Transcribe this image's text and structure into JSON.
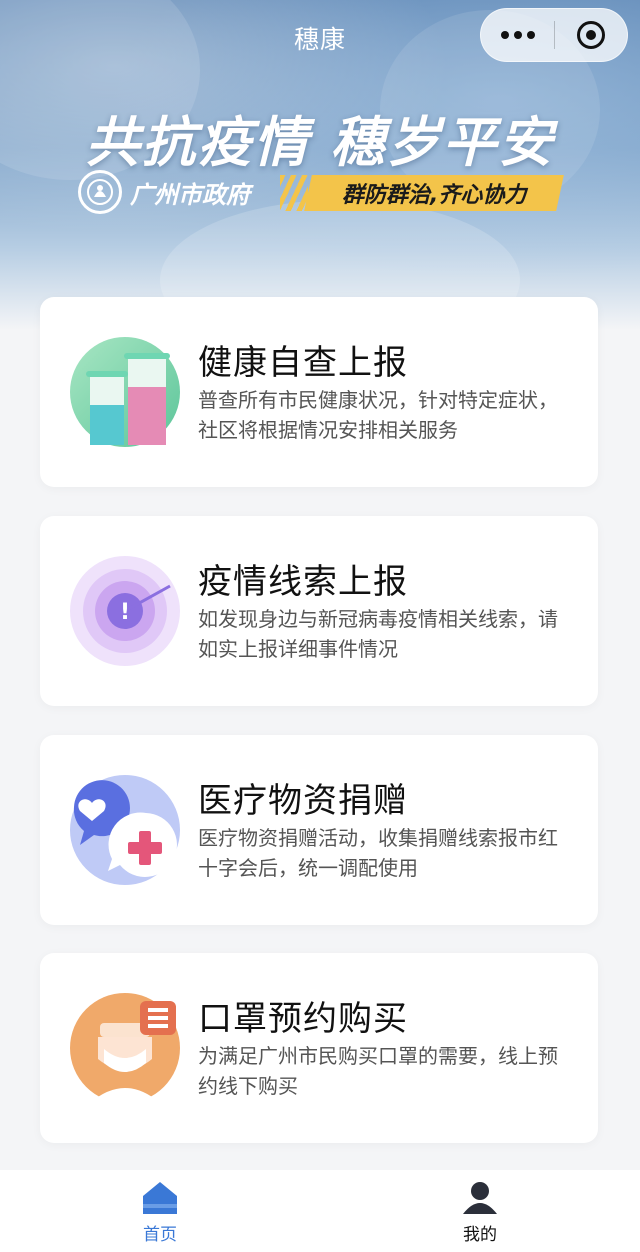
{
  "nav": {
    "title": "穗康"
  },
  "banner": {
    "slogan": "共抗疫情 穗岁平安",
    "gov_name": "广州市政府",
    "motto": "群防群治,齐心协力"
  },
  "cards": [
    {
      "title": "健康自查上报",
      "desc": "普查所有市民健康状况，针对特定症状，社区将根据情况安排相关服务",
      "icon": "test-tubes-icon"
    },
    {
      "title": "疫情线索上报",
      "desc": "如发现身边与新冠病毒疫情相关线索，请如实上报详细事件情况",
      "icon": "radar-alert-icon"
    },
    {
      "title": "医疗物资捐赠",
      "desc": "医疗物资捐赠活动，收集捐赠线索报市红十字会后，统一调配使用",
      "icon": "donation-chat-icon"
    },
    {
      "title": "口罩预约购买",
      "desc": "为满足广州市民购买口罩的需要，线上预约线下购买",
      "icon": "mask-doctor-icon"
    }
  ],
  "tabs": [
    {
      "label": "首页",
      "icon": "home-icon",
      "active": true
    },
    {
      "label": "我的",
      "icon": "user-icon",
      "active": false
    }
  ],
  "colors": {
    "accent": "#3a78d6",
    "motto_bg": "#f3c44a"
  }
}
